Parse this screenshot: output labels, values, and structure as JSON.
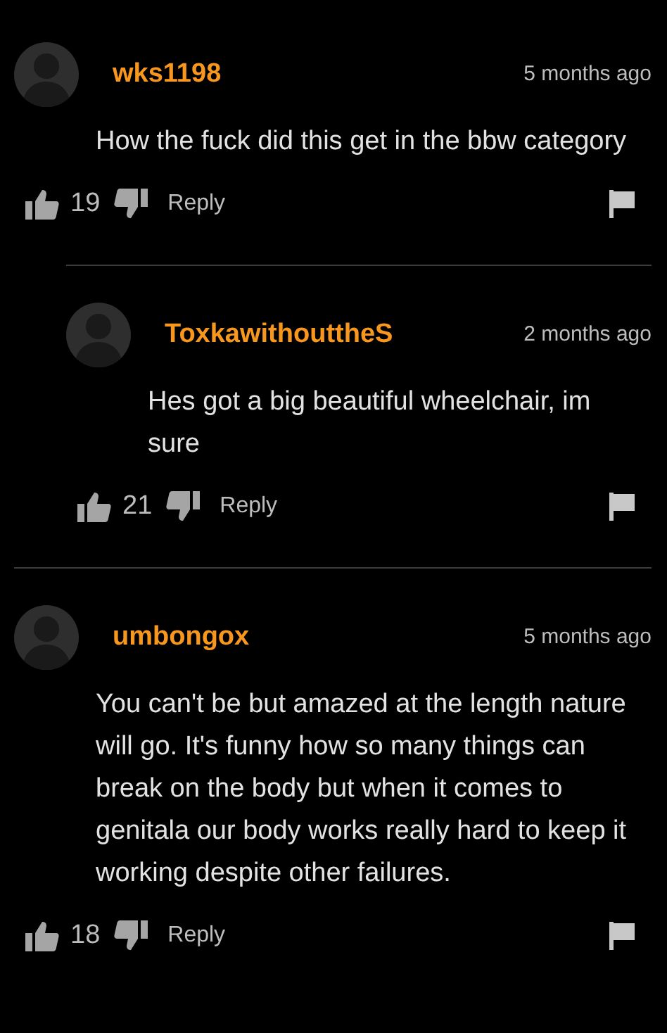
{
  "comments": [
    {
      "username": "wks1198",
      "time": "5 months ago",
      "body": "How the fuck did this get in the bbw category",
      "likes": "19",
      "reply_label": "Reply",
      "replies": [
        {
          "username": "ToxkawithouttheS",
          "time": "2 months ago",
          "body": "Hes got a big beautiful wheelchair, im sure",
          "likes": "21",
          "reply_label": "Reply"
        }
      ]
    },
    {
      "username": "umbongox",
      "time": "5 months ago",
      "body": "You can't be but amazed at the length nature will go. It's funny how so many things can break on the body but when it comes to genitala our body works really hard to keep it working despite other failures.",
      "likes": "18",
      "reply_label": "Reply"
    }
  ]
}
